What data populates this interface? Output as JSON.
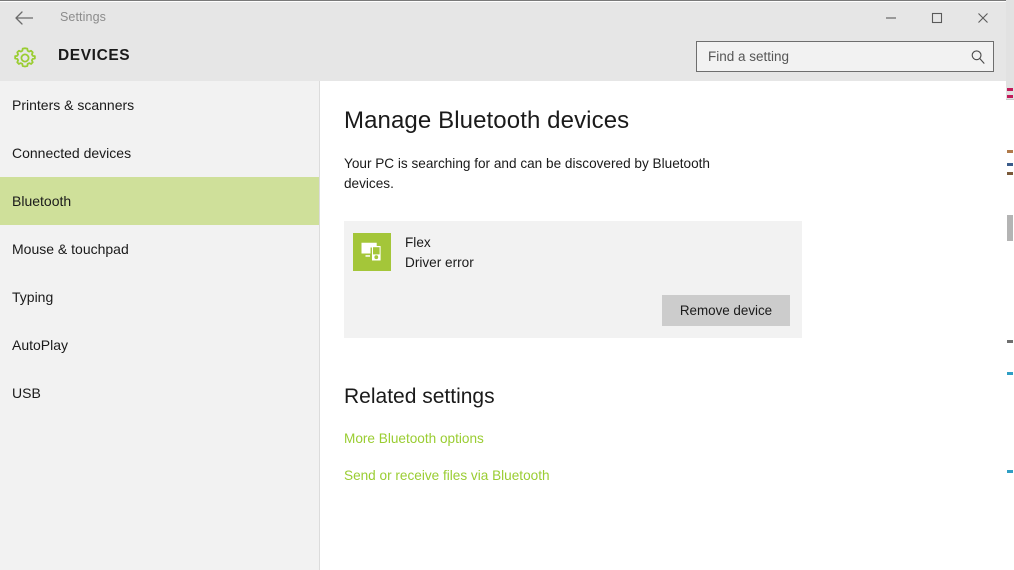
{
  "window": {
    "app_title": "Settings",
    "back_icon": "back-arrow-icon",
    "minimize_label": "Minimize",
    "maximize_label": "Maximize",
    "close_label": "Close"
  },
  "header": {
    "gear_icon": "gear-icon",
    "page_heading": "DEVICES",
    "search": {
      "placeholder": "Find a setting",
      "value": "",
      "icon": "search-icon"
    }
  },
  "sidebar": {
    "items": [
      {
        "label": "Printers & scanners",
        "selected": false
      },
      {
        "label": "Connected devices",
        "selected": false
      },
      {
        "label": "Bluetooth",
        "selected": true
      },
      {
        "label": "Mouse & touchpad",
        "selected": false
      },
      {
        "label": "Typing",
        "selected": false
      },
      {
        "label": "AutoPlay",
        "selected": false
      },
      {
        "label": "USB",
        "selected": false
      }
    ]
  },
  "main": {
    "title": "Manage Bluetooth devices",
    "description": "Your PC is searching for and can be discovered by Bluetooth devices.",
    "device": {
      "icon": "connected-devices-icon",
      "name": "Flex",
      "status": "Driver error",
      "remove_label": "Remove device"
    },
    "related": {
      "title": "Related settings",
      "links": [
        "More Bluetooth options",
        "Send or receive files via Bluetooth"
      ]
    }
  },
  "colors": {
    "accent_green": "#9acd32",
    "selection_green": "#cfe09a",
    "tile_green": "#a4c639",
    "chrome_gray": "#e6e6e6",
    "panel_gray": "#f2f2f2",
    "button_gray": "#cccccc"
  }
}
